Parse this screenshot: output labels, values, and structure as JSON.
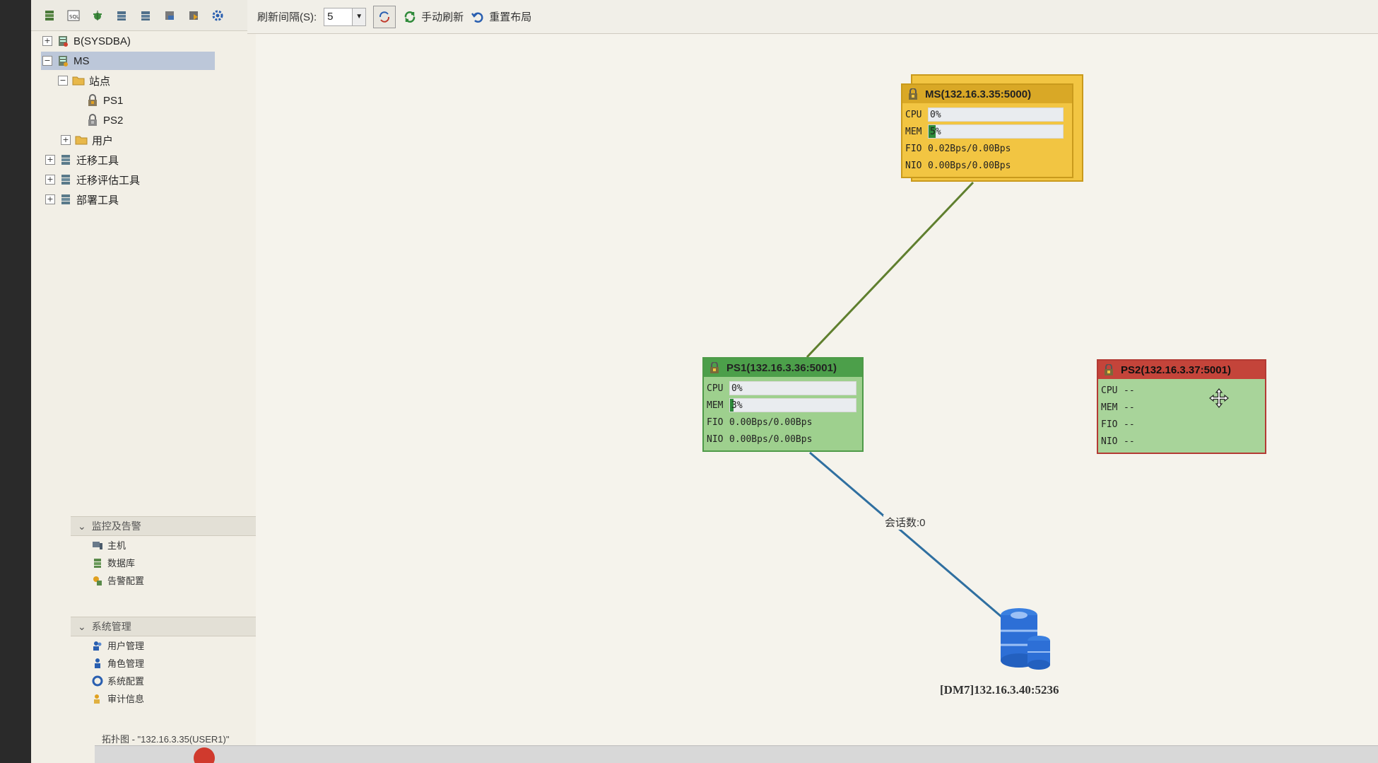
{
  "left_toolbar": {
    "icons": [
      "db-icon",
      "sql-icon",
      "bug-icon",
      "db-up-icon",
      "db-down-icon",
      "db-export-icon",
      "db-import-icon",
      "settings-icon"
    ]
  },
  "tree": {
    "node_b": "B(SYSDBA)",
    "node_ms": "MS",
    "node_sites": "站点",
    "node_ps1": "PS1",
    "node_ps2": "PS2",
    "node_users": "用户",
    "node_migrate": "迁移工具",
    "node_migrate_eval": "迁移评估工具",
    "node_deploy": "部署工具"
  },
  "monitor_section": {
    "title": "监控及告警",
    "items": [
      "主机",
      "数据库",
      "告警配置"
    ]
  },
  "system_section": {
    "title": "系统管理",
    "items": [
      "用户管理",
      "角色管理",
      "系统配置",
      "审计信息"
    ]
  },
  "statusbar": {
    "text": "拓扑图 - \"132.16.3.35(USER1)\""
  },
  "toolbar": {
    "interval_label": "刷新间隔(S):",
    "interval_value": "5",
    "manual_refresh": "手动刷新",
    "reset_layout": "重置布局"
  },
  "nodes": {
    "ms": {
      "title": "MS(132.16.3.35:5000)",
      "cpu_label": "CPU",
      "cpu_value": "0%",
      "cpu_fraction": 0.0,
      "mem_label": "MEM",
      "mem_value": "5%",
      "mem_fraction": 0.05,
      "fio_label": "FIO",
      "fio_value": "0.02Bps/0.00Bps",
      "nio_label": "NIO",
      "nio_value": "0.00Bps/0.00Bps"
    },
    "ps1": {
      "title": "PS1(132.16.3.36:5001)",
      "cpu_label": "CPU",
      "cpu_value": "0%",
      "cpu_fraction": 0.0,
      "mem_label": "MEM",
      "mem_value": "3%",
      "mem_fraction": 0.03,
      "fio_label": "FIO",
      "fio_value": "0.00Bps/0.00Bps",
      "nio_label": "NIO",
      "nio_value": "0.00Bps/0.00Bps"
    },
    "ps2": {
      "title": "PS2(132.16.3.37:5001)",
      "cpu_label": "CPU",
      "cpu_value": "--",
      "mem_label": "MEM",
      "mem_value": "--",
      "fio_label": "FIO",
      "fio_value": "--",
      "nio_label": "NIO",
      "nio_value": "--"
    }
  },
  "link": {
    "session_label": "会话数:0"
  },
  "database": {
    "label": "[DM7]132.16.3.40:5236"
  },
  "colors": {
    "ms_fill": "#f2c542",
    "ps1_fill": "#9ed08e",
    "ps2_header": "#c4443a",
    "link_ms_ps1": "#5f7f2e",
    "link_ps1_db": "#2f6fa0",
    "db_blue": "#2d6fd6"
  }
}
